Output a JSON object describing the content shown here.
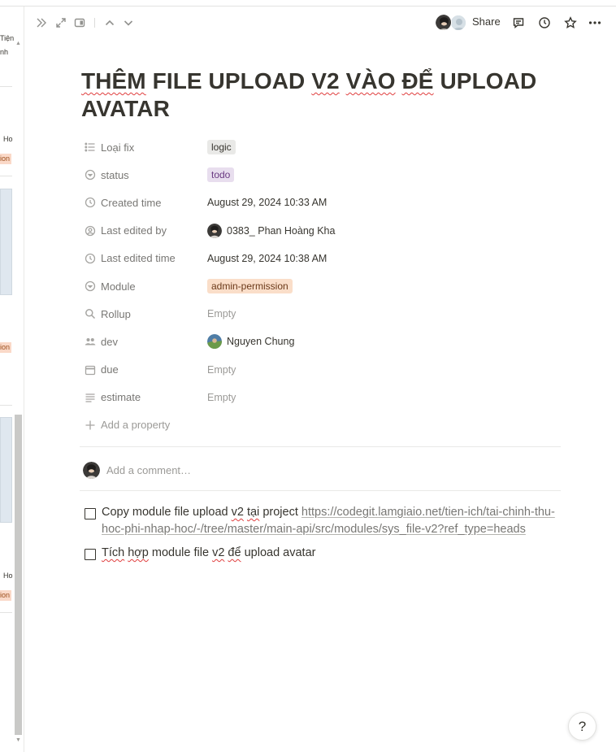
{
  "board": {
    "snippets": [
      "Tiện",
      "nh",
      "Ho",
      "ion",
      "ion",
      "Ho",
      "ion"
    ]
  },
  "toolbar": {
    "share_label": "Share",
    "icons": [
      "double-chevron-right-icon",
      "expand-icon",
      "side-peek-icon",
      "chevron-up-icon",
      "chevron-down-icon",
      "comment-icon",
      "history-icon",
      "star-icon",
      "more-icon"
    ]
  },
  "page": {
    "title_parts": [
      "THÊM",
      " FILE UPLOAD ",
      "V2",
      " ",
      "VÀO",
      " ",
      "ĐỂ",
      " UPLOAD AVATAR"
    ]
  },
  "properties": [
    {
      "name": "Loại fix",
      "value": "logic"
    },
    {
      "name": "status",
      "value": "todo"
    },
    {
      "name": "Created time",
      "value": "August 29, 2024 10:33 AM"
    },
    {
      "name": "Last edited by",
      "value": "0383_ Phan Hoàng Kha"
    },
    {
      "name": "Last edited time",
      "value": "August 29, 2024 10:38 AM"
    },
    {
      "name": "Module",
      "value": "admin-permission"
    },
    {
      "name": "Rollup",
      "value": "Empty"
    },
    {
      "name": "dev",
      "value": "Nguyen Chung"
    },
    {
      "name": "due",
      "value": "Empty"
    },
    {
      "name": "estimate",
      "value": "Empty"
    }
  ],
  "add_property_label": "Add a property",
  "comment_placeholder": "Add a comment…",
  "todos": [
    {
      "parts": [
        "Copy module file upload ",
        "v2",
        " ",
        "tại",
        " project "
      ],
      "link": "https://codegit.lamgiaio.net/tien-ich/tai-chinh-thu-hoc-phi-nhap-hoc/-/tree/master/main-api/src/modules/sys_file-v2?ref_type=heads"
    },
    {
      "parts": [
        "Tích",
        " ",
        "hợp",
        " module file ",
        "v2",
        " ",
        "để",
        " upload avatar"
      ]
    }
  ],
  "help_label": "?"
}
